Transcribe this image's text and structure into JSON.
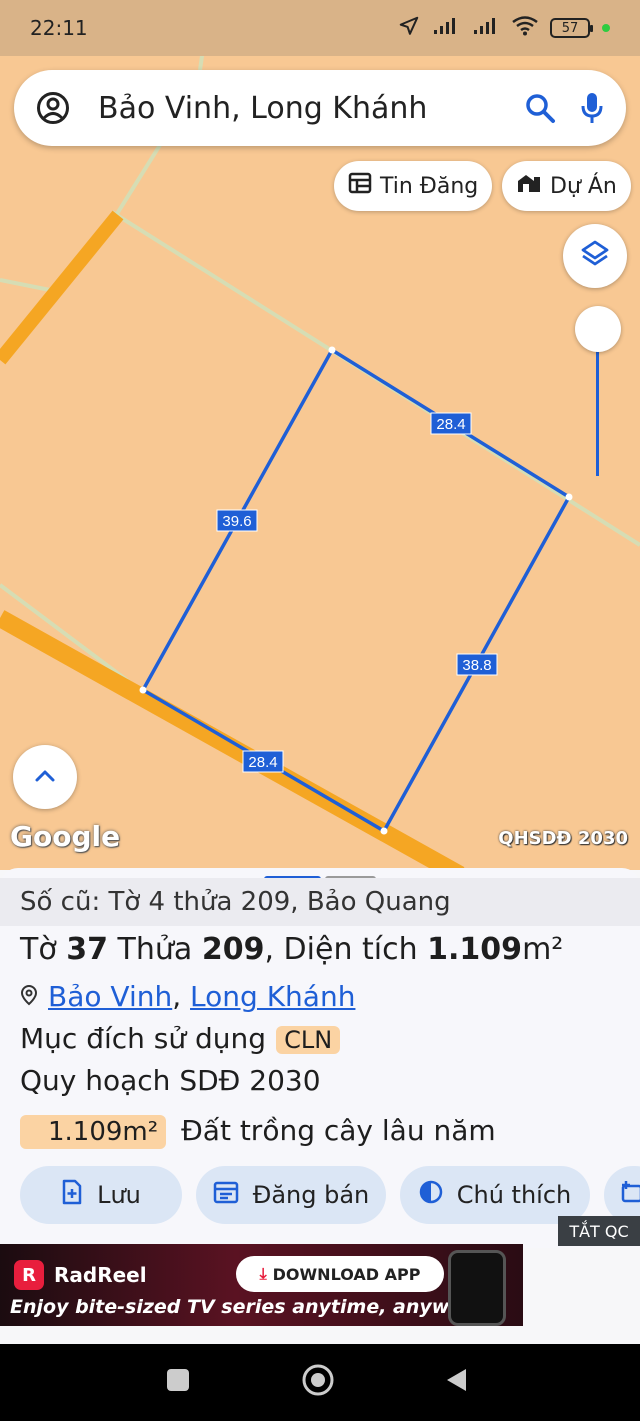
{
  "status_bar": {
    "time": "22:11",
    "battery": "57"
  },
  "search": {
    "query": "Bảo Vinh, Long Khánh"
  },
  "chips": {
    "tin_dang": "Tin Đăng",
    "du_an": "Dự Án"
  },
  "map": {
    "edge_lengths": {
      "top": "28.4",
      "left": "39.6",
      "right": "38.8",
      "bottom": "28.4"
    },
    "logo": "Google",
    "layer_label": "QHSDĐ 2030"
  },
  "parcel": {
    "old_info": "Số cũ: Tờ 4 thửa 209, Bảo Quang",
    "to_label": "Tờ",
    "to_value": "37",
    "thua_label": "Thửa",
    "thua_value": "209",
    "dien_tich_label": "Diện tích",
    "area_value": "1.109",
    "area_unit": "m²",
    "ward": "Bảo Vinh",
    "separator": ",",
    "city": "Long Khánh",
    "purpose_label": "Mục đích sử dụng",
    "purpose_code": "CLN",
    "plan_label": "Quy hoạch SDĐ 2030",
    "plan_area": "1.109m²",
    "plan_desc": "Đất trồng cây lâu năm"
  },
  "actions": {
    "save": "Lưu",
    "post_sale": "Đăng bán",
    "legend": "Chú thích"
  },
  "ad": {
    "hide_label": "TẮT QC",
    "brand": "RadReel",
    "cta": "DOWNLOAD APP",
    "tagline": "Enjoy bite-sized TV series anytime, anywhere!"
  },
  "colors": {
    "accent": "#1f5fd6",
    "map_bg": "#f8c893",
    "road": "#f5a623",
    "badge": "#fbd3a3"
  }
}
